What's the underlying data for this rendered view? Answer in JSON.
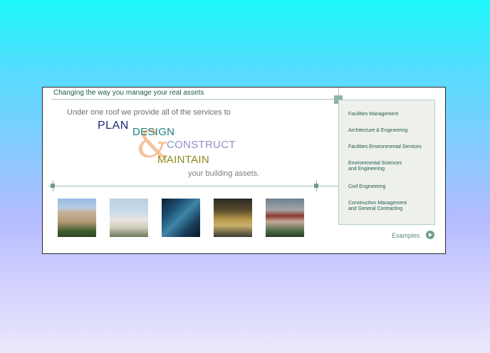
{
  "header": {
    "tagline": "Changing the way you manage your real assets"
  },
  "hero": {
    "intro": "Under one roof we provide all of the services to",
    "word_plan": "PLAN",
    "word_design": "DESIGN",
    "ampersand": "&",
    "word_construct": "CONSTRUCT",
    "word_maintain": "MAINTAIN",
    "outro": "your building assets."
  },
  "sidebar": {
    "items": [
      {
        "label": "Facilities Management"
      },
      {
        "label": "Architecture & Engineering"
      },
      {
        "label": "Facilities Environmental Services"
      },
      {
        "label": "Environmental Sciences\nand Engineering"
      },
      {
        "label": "Civil Engineering"
      },
      {
        "label": "Construction Management\nand General Contracting"
      }
    ]
  },
  "examples": {
    "label": "Examples",
    "icon": "play-circle-icon"
  },
  "thumbnails": [
    {
      "name": "building-photo-1"
    },
    {
      "name": "building-photo-2"
    },
    {
      "name": "water-photo"
    },
    {
      "name": "caution-photo"
    },
    {
      "name": "storefront-photo"
    }
  ],
  "colors": {
    "accent_green": "#1d5a49",
    "plan_blue": "#1d2b75",
    "design_teal": "#22807c",
    "construct_lavender": "#8f8fc8",
    "maintain_olive": "#8a8a1c",
    "ampersand_peach": "#f6c39b"
  }
}
